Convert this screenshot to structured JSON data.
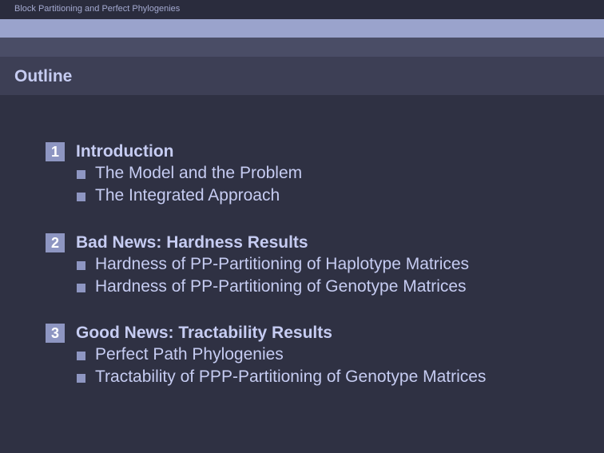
{
  "header": {
    "short_title": "Block Partitioning and Perfect Phylogenies"
  },
  "frame": {
    "title": "Outline"
  },
  "outline": [
    {
      "number": "1",
      "title": "Introduction",
      "subsections": [
        "The Model and the Problem",
        "The Integrated Approach"
      ]
    },
    {
      "number": "2",
      "title": "Bad News: Hardness Results",
      "subsections": [
        "Hardness of PP-Partitioning of Haplotype Matrices",
        "Hardness of PP-Partitioning of Genotype Matrices"
      ]
    },
    {
      "number": "3",
      "title": "Good News: Tractability Results",
      "subsections": [
        "Perfect Path Phylogenies",
        "Tractability of PPP-Partitioning of Genotype Matrices"
      ]
    }
  ],
  "colors": {
    "background": "#2f3143",
    "accent": "#8e96c2",
    "text": "#c6ccf2",
    "band_light": "#9aa3cc"
  }
}
